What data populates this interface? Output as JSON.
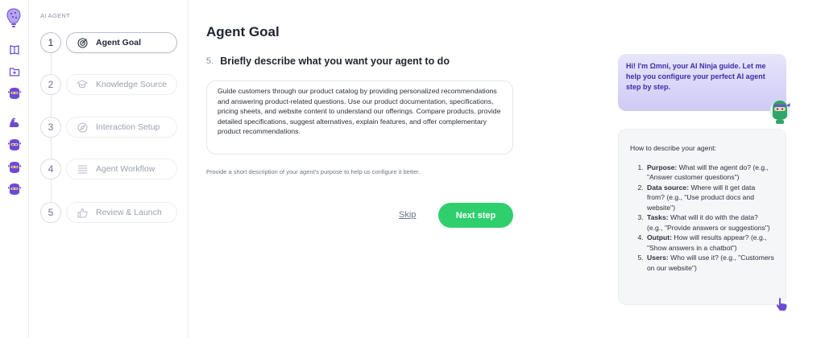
{
  "sidebar": {
    "caption": "AI AGENT",
    "steps": [
      {
        "number": "1",
        "label": "Agent Goal",
        "icon": "target-icon",
        "active": true
      },
      {
        "number": "2",
        "label": "Knowledge Source",
        "icon": "graduation-cap-icon",
        "active": false
      },
      {
        "number": "3",
        "label": "Interaction Setup",
        "icon": "compass-icon",
        "active": false
      },
      {
        "number": "4",
        "label": "Agent Workflow",
        "icon": "list-icon",
        "active": false
      },
      {
        "number": "5",
        "label": "Review & Launch",
        "icon": "thumbs-up-icon",
        "active": false
      }
    ]
  },
  "main": {
    "title": "Agent Goal",
    "question_number": "5.",
    "question": "Briefly describe what you want your agent to do",
    "description": "Guide customers through our product catalog by providing personalized recommendations and answering product-related questions. Use our product documentation, specifications, pricing sheets, and website content to understand our offerings. Compare products, provide detailed specifications, suggest alternatives, explain features, and offer complementary product recommendations.",
    "hint": "Provide a short description of your agent's purpose to help us configure it better.",
    "skip_label": "Skip",
    "next_label": "Next step"
  },
  "assistant": {
    "greeting": "Hi! I'm Ωmni, your AI Ninja guide. Let me help you configure your perfect AI agent step by step.",
    "tips_lead": "How to describe your agent:",
    "tips": [
      {
        "title": "Purpose:",
        "text": "What will the agent do? (e.g., \"Answer customer questions\")"
      },
      {
        "title": "Data source:",
        "text": "Where will it get data from? (e.g., \"Use product docs and website\")"
      },
      {
        "title": "Tasks:",
        "text": "What will it do with the data? (e.g., \"Provide answers or suggestions\")"
      },
      {
        "title": "Output:",
        "text": "How will results appear? (e.g., \"Show answers in a chatbot\")"
      },
      {
        "title": "Users:",
        "text": "Who will use it? (e.g., \"Customers on our website\")"
      }
    ]
  },
  "colors": {
    "accent_green": "#2fcf6e",
    "bubble_text": "#3b2ea6",
    "brand_purple": "#6a4bd6"
  }
}
